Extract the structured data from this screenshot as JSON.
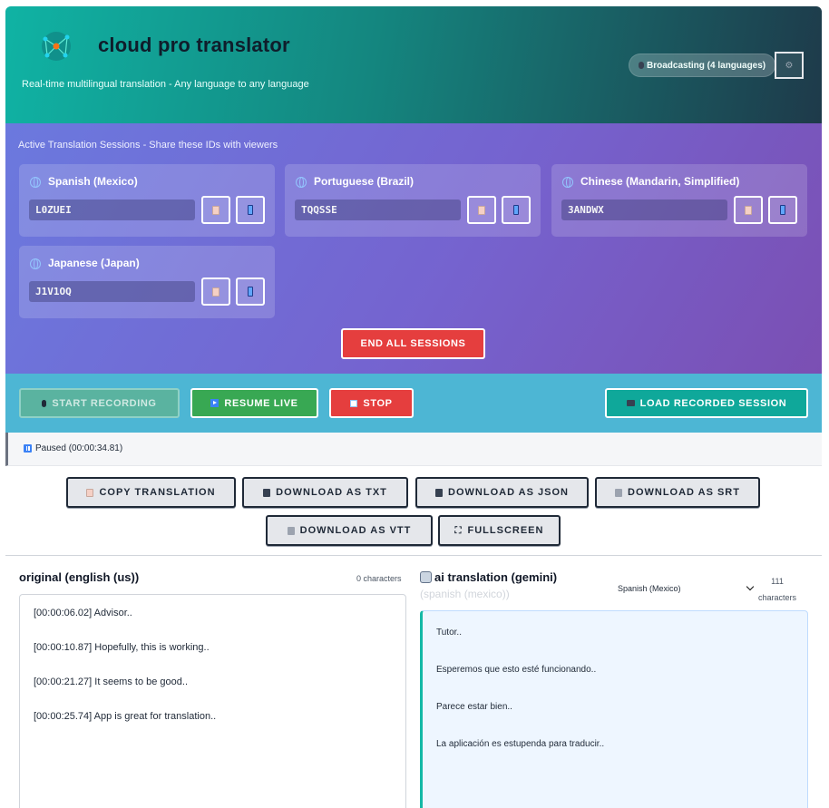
{
  "header": {
    "title": "cloud pro translator",
    "subtitle": "Real-time multilingual translation - Any language to any language",
    "broadcast_badge": "Broadcasting (4 languages)",
    "broadcast_icon": "microphone-icon",
    "settings_icon": "gear-icon"
  },
  "sessions": {
    "title": "Active Translation Sessions - Share these IDs with viewers",
    "cards": [
      {
        "language": "Spanish (Mexico)",
        "id": "L0ZUEI"
      },
      {
        "language": "Portuguese (Brazil)",
        "id": "TQQSSE"
      },
      {
        "language": "Chinese (Mandarin, Simplified)",
        "id": "3ANDWX"
      },
      {
        "language": "Japanese (Japan)",
        "id": "J1V1OQ"
      }
    ],
    "end_all_label": "END ALL SESSIONS"
  },
  "controls": {
    "start_label": "START RECORDING",
    "resume_label": "RESUME LIVE",
    "stop_label": "STOP",
    "load_label": "LOAD RECORDED SESSION"
  },
  "status": {
    "text": "Paused (00:00:34.81)"
  },
  "export": {
    "copy_label": "COPY TRANSLATION",
    "txt_label": "DOWNLOAD AS TXT",
    "json_label": "DOWNLOAD AS JSON",
    "srt_label": "DOWNLOAD AS SRT",
    "vtt_label": "DOWNLOAD AS VTT",
    "fullscreen_label": "FULLSCREEN"
  },
  "original": {
    "title": "original (english (us))",
    "char_count": "0 characters",
    "lines": [
      "[00:00:06.02] Advisor..",
      "[00:00:10.87] Hopefully, this is working..",
      "[00:00:21.27] It seems to be good..",
      "[00:00:25.74] App is great for translation.."
    ]
  },
  "translation": {
    "title": "ai translation (gemini)",
    "subtitle": "(spanish (mexico))",
    "selected_language": "Spanish (Mexico)",
    "char_count_number": "111",
    "char_count_unit": "characters",
    "lines": [
      "Tutor..",
      "Esperemos que esto esté funcionando..",
      "Parece estar bien..",
      "La aplicación es estupenda para traducir.."
    ]
  },
  "colors": {
    "header_start": "#10b3a4",
    "header_end": "#1e3a4a",
    "sessions_bg": "#7563cf",
    "controls_bg": "#4db6d4",
    "danger": "#e53e3e",
    "success": "#38a853",
    "teal": "#0fa89a"
  }
}
